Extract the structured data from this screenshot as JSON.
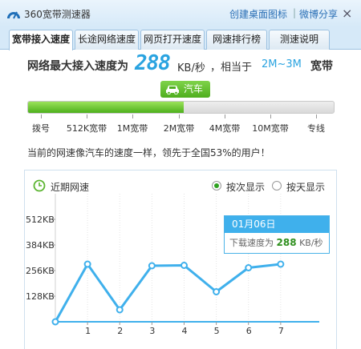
{
  "window": {
    "title": "360宽带测速器",
    "create_shortcut": "创建桌面图标",
    "separator": "|",
    "share": "微博分享",
    "close": "×"
  },
  "tabs": [
    {
      "label": "宽带接入速度",
      "active": true
    },
    {
      "label": "长途网络速度",
      "active": false
    },
    {
      "label": "网页打开速度",
      "active": false
    },
    {
      "label": "网速排行榜",
      "active": false
    },
    {
      "label": "测速说明",
      "active": false
    }
  ],
  "summary": {
    "prefix": "网络最大接入速度为",
    "speed": "288",
    "unit": "KB/秒",
    "equiv": "，相当于",
    "range": "2M~3M",
    "band": "宽带"
  },
  "badge": {
    "label": "汽车",
    "icon": "car-icon"
  },
  "progress": {
    "fill_fraction": 0.51,
    "colors": {
      "fill": "#5cc12a",
      "track": "#e3e3e3"
    },
    "scale_labels": [
      "拨号",
      "512K宽带",
      "1M宽带",
      "2M宽带",
      "4M宽带",
      "10M宽带",
      "专线"
    ]
  },
  "comparison": "当前的网速像汽车的速度一样，领先于全国53%的用户！",
  "chart": {
    "title": "近期网速",
    "options": [
      {
        "label": "按次显示",
        "selected": true
      },
      {
        "label": "按天显示",
        "selected": false
      }
    ],
    "tooltip": {
      "date": "01月06日",
      "label": "下载速度为",
      "value": "288",
      "unit": "KB/秒"
    }
  },
  "chart_data": {
    "type": "line",
    "x": [
      0,
      1,
      2,
      3,
      4,
      5,
      6,
      7
    ],
    "x_tick_labels": [
      "1",
      "2",
      "3",
      "4",
      "5",
      "6",
      "7"
    ],
    "values": [
      0,
      288,
      60,
      280,
      282,
      150,
      270,
      288
    ],
    "y_ticks": [
      128,
      256,
      384,
      512
    ],
    "y_tick_labels": [
      "128KB",
      "256KB",
      "384KB",
      "512KB"
    ],
    "ylim": [
      0,
      600
    ],
    "xlim": [
      0,
      8.2
    ],
    "grid": "vertical dotted",
    "series_color": "#3fb0ec"
  }
}
